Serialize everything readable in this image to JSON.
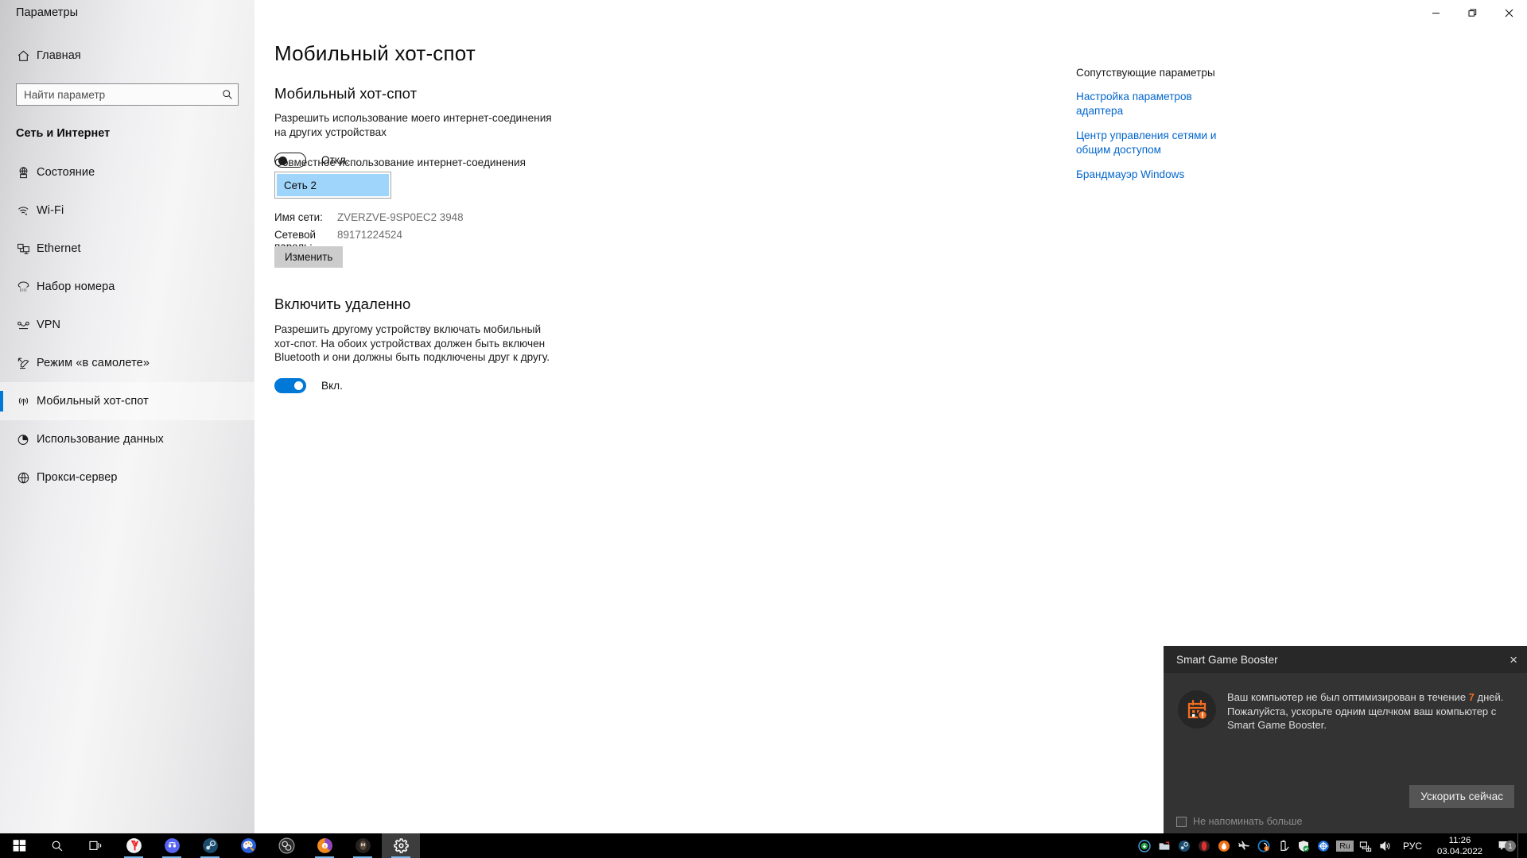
{
  "window": {
    "app_title": "Параметры",
    "minimize_label": "Свернуть",
    "restore_label": "Развернуть",
    "close_label": "Закрыть"
  },
  "sidebar": {
    "home_label": "Главная",
    "search_placeholder": "Найти параметр",
    "search_value": "",
    "group_title": "Сеть и Интернет",
    "items": [
      {
        "label": "Состояние",
        "icon": "network-status-icon",
        "selected": false
      },
      {
        "label": "Wi-Fi",
        "icon": "wifi-icon",
        "selected": false
      },
      {
        "label": "Ethernet",
        "icon": "ethernet-icon",
        "selected": false
      },
      {
        "label": "Набор номера",
        "icon": "dialup-icon",
        "selected": false
      },
      {
        "label": "VPN",
        "icon": "vpn-icon",
        "selected": false
      },
      {
        "label": "Режим «в самолете»",
        "icon": "airplane-icon",
        "selected": false
      },
      {
        "label": "Мобильный хот-спот",
        "icon": "hotspot-icon",
        "selected": true
      },
      {
        "label": "Использование данных",
        "icon": "data-usage-icon",
        "selected": false
      },
      {
        "label": "Прокси-сервер",
        "icon": "proxy-icon",
        "selected": false
      }
    ]
  },
  "main": {
    "page_title": "Мобильный хот-спот",
    "hotspot": {
      "heading": "Мобильный хот-спот",
      "description": "Разрешить использование моего интернет-соединения на других устройствах",
      "toggle_state": "off",
      "toggle_label": "Откл."
    },
    "share": {
      "label": "Совместное использование интернет-соединения",
      "selected_option": "Сеть 2"
    },
    "info": [
      {
        "key": "Имя сети:",
        "value": "ZVERZVE-9SP0EC2 3948"
      },
      {
        "key": "Сетевой пароль:",
        "value": "89171224524"
      }
    ],
    "edit_button": "Изменить",
    "remote": {
      "heading": "Включить удаленно",
      "description": "Разрешить другому устройству включать мобильный хот-спот. На обоих устройствах должен быть включен Bluetooth и они должны быть подключены друг к другу.",
      "toggle_state": "on",
      "toggle_label": "Вкл."
    }
  },
  "related": {
    "title": "Сопутствующие параметры",
    "links": [
      "Настройка параметров адаптера",
      "Центр управления сетями и общим доступом",
      "Брандмауэр Windows"
    ]
  },
  "notification": {
    "title": "Smart Game Booster",
    "message_before": "Ваш компьютер не был оптимизирован в течение ",
    "message_highlight": "7",
    "message_after": " дней. Пожалуйста, ускорьте одним щелчком ваш компьютер с Smart Game Booster.",
    "action_button": "Ускорить сейчас",
    "dont_remind_label": "Не напоминать больше",
    "close_label": "×",
    "icon": "calendar-alert-icon",
    "accent_color": "#ef6c1f"
  },
  "taskbar": {
    "items": [
      {
        "name": "start-button",
        "icon": "windows-logo-icon"
      },
      {
        "name": "search-button",
        "icon": "search-icon"
      },
      {
        "name": "task-view-button",
        "icon": "task-view-icon"
      },
      {
        "name": "yandex-browser",
        "icon": "yandex-icon",
        "running": true
      },
      {
        "name": "discord",
        "icon": "discord-icon",
        "running": true
      },
      {
        "name": "steam",
        "icon": "steam-icon",
        "running": true
      },
      {
        "name": "paint",
        "icon": "paint-icon",
        "running": false
      },
      {
        "name": "obs-studio",
        "icon": "obs-icon",
        "running": false
      },
      {
        "name": "browser",
        "icon": "browser-icon",
        "running": true
      },
      {
        "name": "game-app",
        "icon": "game-icon",
        "running": true
      },
      {
        "name": "settings-app",
        "icon": "gear-icon",
        "running": true,
        "active": true
      }
    ],
    "tray": [
      {
        "name": "tray-updater",
        "icon": "download-circle-icon"
      },
      {
        "name": "tray-explorer",
        "icon": "folder-icon"
      },
      {
        "name": "tray-steam",
        "icon": "steam-icon"
      },
      {
        "name": "tray-opera",
        "icon": "opera-icon"
      },
      {
        "name": "tray-antivirus",
        "icon": "flame-icon"
      },
      {
        "name": "tray-airplane",
        "icon": "airplane-icon"
      },
      {
        "name": "tray-driver",
        "icon": "driver-alert-icon"
      },
      {
        "name": "tray-usb",
        "icon": "usb-eject-icon"
      },
      {
        "name": "tray-security",
        "icon": "shield-check-icon"
      },
      {
        "name": "tray-sync",
        "icon": "sync-icon"
      },
      {
        "name": "tray-layout",
        "icon": "ru-layout-icon",
        "label": "Ru"
      },
      {
        "name": "tray-network",
        "icon": "ethernet-icon"
      },
      {
        "name": "tray-volume",
        "icon": "speaker-icon"
      }
    ],
    "language": "РУС",
    "time": "11:26",
    "date": "03.04.2022",
    "notification_count": "1"
  },
  "colors": {
    "accent": "#0078d7",
    "link": "#0366cc",
    "selection": "#9fd4fb",
    "toast_bg": "#333333"
  }
}
